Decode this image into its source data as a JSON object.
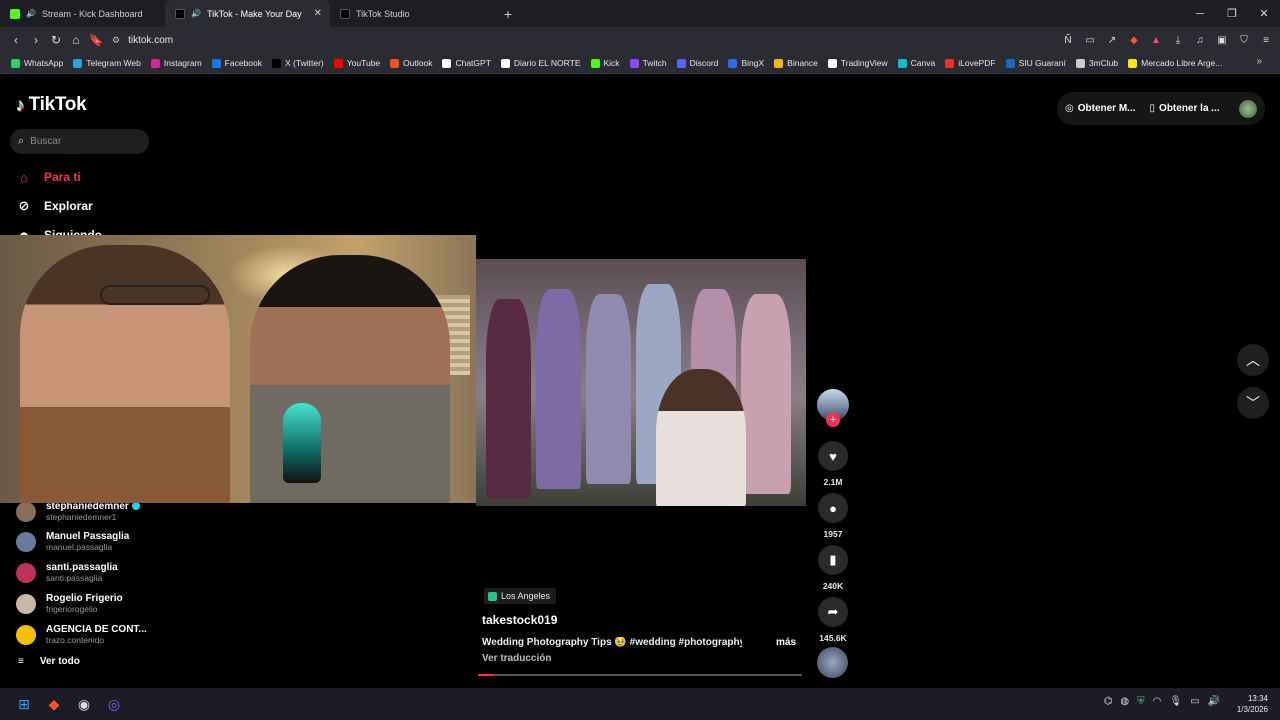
{
  "browser": {
    "tabs": [
      {
        "label": "Stream - Kick Dashboard",
        "color": "#53fc18"
      },
      {
        "label": "TikTok - Make Your Day",
        "color": "#ffffff"
      },
      {
        "label": "TikTok Studio",
        "color": "#ffffff"
      }
    ],
    "url": "tiktok.com",
    "bookmarks": [
      {
        "label": "WhatsApp",
        "color": "#25d366"
      },
      {
        "label": "Telegram Web",
        "color": "#2aa3df"
      },
      {
        "label": "Instagram",
        "color": "#d6249f"
      },
      {
        "label": "Facebook",
        "color": "#1877f2"
      },
      {
        "label": "X (Twitter)",
        "color": "#000000"
      },
      {
        "label": "YouTube",
        "color": "#ff0000"
      },
      {
        "label": "Outlook",
        "color": "#f25022"
      },
      {
        "label": "ChatGPT",
        "color": "#ffffff"
      },
      {
        "label": "Diario EL NORTE",
        "color": "#ffffff"
      },
      {
        "label": "Kick",
        "color": "#53fc18"
      },
      {
        "label": "Twitch",
        "color": "#9146ff"
      },
      {
        "label": "Discord",
        "color": "#5865f2"
      },
      {
        "label": "BingX",
        "color": "#2a6bf2"
      },
      {
        "label": "Binance",
        "color": "#f0b90b"
      },
      {
        "label": "TradingView",
        "color": "#ffffff"
      },
      {
        "label": "Canva",
        "color": "#00c4cc"
      },
      {
        "label": "iLovePDF",
        "color": "#e5322d"
      },
      {
        "label": "SIU Guaraní",
        "color": "#1a66c9"
      },
      {
        "label": "3mClub",
        "color": "#cccccc"
      },
      {
        "label": "Mercado Libre Arge...",
        "color": "#ffe600"
      }
    ]
  },
  "tiktok": {
    "logo": "TikTok",
    "search_placeholder": "Buscar",
    "nav": [
      {
        "label": "Para ti",
        "icon": "home-icon"
      },
      {
        "label": "Explorar",
        "icon": "compass-icon"
      },
      {
        "label": "Siguiendo",
        "icon": "following-icon"
      }
    ],
    "following": [
      {
        "name": "stephaniedemner",
        "user": "stephaniedemner1",
        "verified": true,
        "color": "#8a6d5a"
      },
      {
        "name": "Manuel Passaglia",
        "user": "manuel.passaglia",
        "verified": false,
        "color": "#6a7a9a"
      },
      {
        "name": "santi.passaglia",
        "user": "santi.passaglia",
        "verified": false,
        "color": "#c0325a"
      },
      {
        "name": "Rogelio Frigerio",
        "user": "frigeriorogelio",
        "verified": false,
        "color": "#c9b8a8"
      },
      {
        "name": "AGENCIA DE CONT...",
        "user": "trazo.contenido",
        "verified": false,
        "color": "#f2c200"
      }
    ],
    "see_all": "Ver todo",
    "top_actions": [
      "Obtener M...",
      "Obtener la ..."
    ],
    "post": {
      "location": "Los Angeles",
      "author": "takestock019",
      "caption": "Wedding Photography Tips 🥹 #wedding #photography ...",
      "more": "más",
      "translate": "Ver traducción",
      "progress": 0.05,
      "likes": "2.1M",
      "comments": "1957",
      "saves": "240K",
      "shares": "145.6K"
    }
  },
  "taskbar": {
    "time": "13:34",
    "date": "1/3/2026"
  }
}
